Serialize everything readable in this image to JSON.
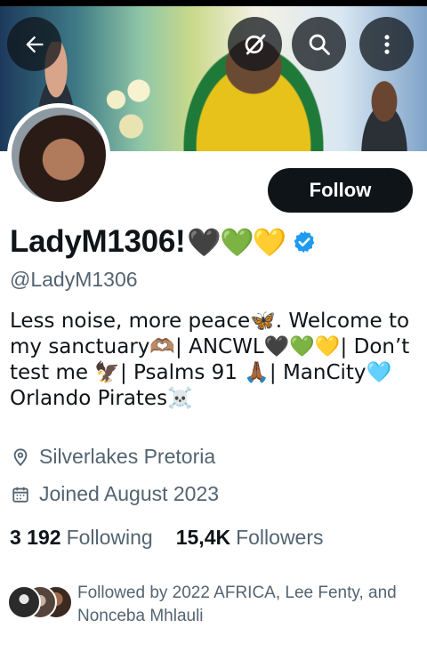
{
  "profile": {
    "display_name": "LadyM1306!",
    "name_emojis": "🖤💚💛",
    "handle": "@LadyM1306",
    "verified": true,
    "bio_lines": [
      "Less noise, more peace🦋. Welcome to",
      "my sanctuary🫶🏽| ANCWL🖤💚💛| Don’t",
      "test me 🦅| Psalms 91 🙏🏾| ManCity🩵",
      "Orlando Pirates☠️"
    ],
    "location": "Silverlakes Pretoria",
    "joined": "Joined August 2023",
    "following_count": "3 192",
    "following_label": "Following",
    "followers_count": "15,4K",
    "followers_label": "Followers",
    "followed_by": "Followed by 2022 AFRICA, Lee Fenty, and Nonceba Mhlauli"
  },
  "actions": {
    "follow_label": "Follow"
  },
  "icons": {
    "back": "back-arrow-icon",
    "grok": "grok-icon",
    "search": "search-icon",
    "more": "more-vertical-icon",
    "verified": "verified-badge-icon",
    "location": "location-pin-icon",
    "calendar": "calendar-icon"
  },
  "colors": {
    "verified_blue": "#1d9bf0",
    "text_primary": "#0f1419",
    "text_secondary": "#536471",
    "follow_button": "#0f1419"
  }
}
